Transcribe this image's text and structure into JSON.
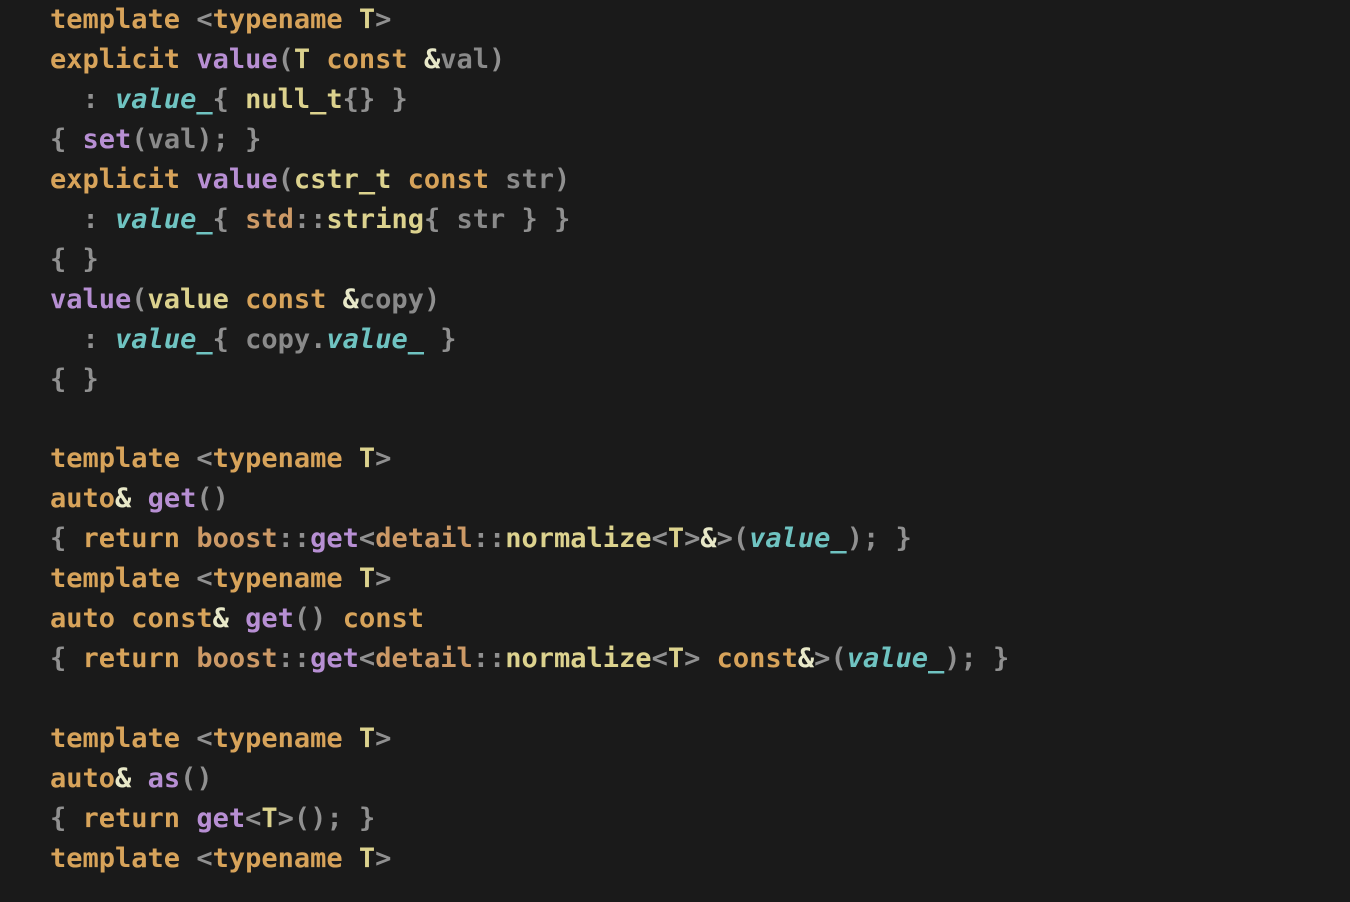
{
  "tokens": {
    "template": "template",
    "typename": "typename",
    "explicit": "explicit",
    "const": "const",
    "auto": "auto",
    "return": "return",
    "T": "T",
    "value": "value",
    "value_": "value_",
    "null_t": "null_t",
    "set": "set",
    "val": "val",
    "cstr_t": "cstr_t",
    "str": "str",
    "std": "std",
    "string": "string",
    "copy": "copy",
    "get": "get",
    "boost": "boost",
    "detail": "detail",
    "normalize": "normalize",
    "as": "as",
    "amp": "&",
    "lt": "<",
    "gt": ">",
    "lparen": "(",
    "rparen": ")",
    "lbrace": "{",
    "rbrace": "}",
    "colon": ":",
    "dcolon": "::",
    "semi": ";",
    "dot": ".",
    "sp": " "
  }
}
